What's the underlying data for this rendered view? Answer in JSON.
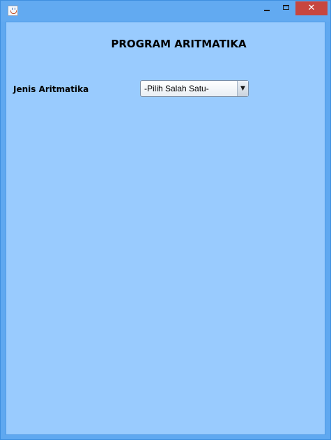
{
  "window": {
    "title": "",
    "controls": {
      "minimize_icon": "minimize-icon",
      "maximize_icon": "maximize-icon",
      "close_symbol": "✕"
    }
  },
  "form": {
    "title": "PROGRAM ARITMATIKA",
    "arithmetic_type": {
      "label": "Jenis Aritmatika",
      "selected": "-Pilih Salah Satu-",
      "arrow": "▼"
    }
  },
  "colors": {
    "titlebar": "#62aaf1",
    "panel": "#99cbfe",
    "close_button": "#c7463f"
  }
}
